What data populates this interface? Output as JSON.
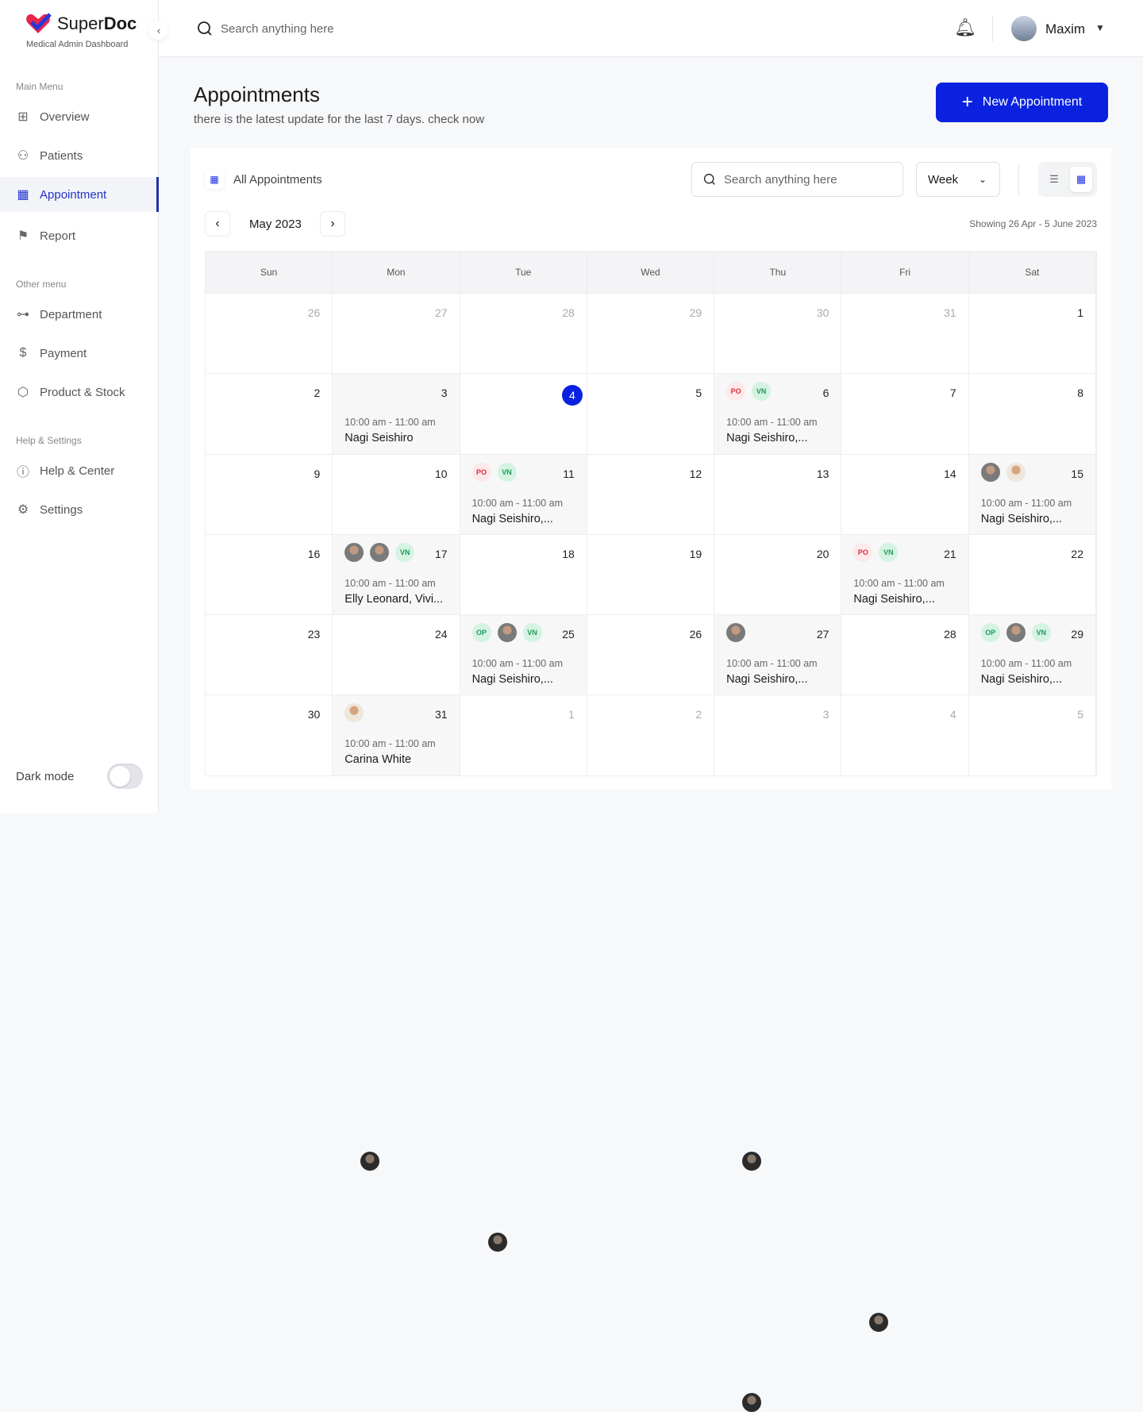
{
  "brand": {
    "name_a": "Super",
    "name_b": "Doc",
    "subtitle": "Medical Admin Dashboard",
    "accent": "#0a22e0"
  },
  "sidebar": {
    "main_label": "Main Menu",
    "main": [
      {
        "label": "Overview",
        "icon": "grid-icon"
      },
      {
        "label": "Patients",
        "icon": "users-icon"
      },
      {
        "label": "Appointment",
        "icon": "calendar-icon",
        "active": true
      },
      {
        "label": "Report",
        "icon": "flag-icon"
      }
    ],
    "other_label": "Other menu",
    "other": [
      {
        "label": "Department",
        "icon": "hierarchy-icon"
      },
      {
        "label": "Payment",
        "icon": "dollar-icon"
      },
      {
        "label": "Product & Stock",
        "icon": "box-icon"
      }
    ],
    "help_label": "Help & Settings",
    "help": [
      {
        "label": "Help & Center",
        "icon": "info-icon"
      },
      {
        "label": "Settings",
        "icon": "gear-icon"
      }
    ],
    "dark_mode": "Dark mode",
    "dark_mode_on": false
  },
  "topbar": {
    "search_placeholder": "Search anything here",
    "user": "Maxim"
  },
  "page": {
    "title": "Appointments",
    "subtitle": "there is the latest update for the last 7 days. check now",
    "new_button": "New Appointment"
  },
  "calendar": {
    "section": "All Appointments",
    "search_placeholder": "Search anything here",
    "view": "Week",
    "month": "May 2023",
    "showing": "Showing 26 Apr - 5 June 2023",
    "days": [
      "Sun",
      "Mon",
      "Tue",
      "Wed",
      "Thu",
      "Fri",
      "Sat"
    ],
    "weeks": [
      [
        {
          "d": "26",
          "m": true
        },
        {
          "d": "27",
          "m": true
        },
        {
          "d": "28",
          "m": true
        },
        {
          "d": "29",
          "m": true
        },
        {
          "d": "30",
          "m": true
        },
        {
          "d": "31",
          "m": true
        },
        {
          "d": "1"
        }
      ],
      [
        {
          "d": "2"
        },
        {
          "d": "3",
          "ev": {
            "avatars": [
              "dark"
            ],
            "time": "10:00 am - 11:00 am",
            "name": "Nagi Seishiro"
          }
        },
        {
          "d": "4",
          "today": true
        },
        {
          "d": "5"
        },
        {
          "d": "6",
          "ev": {
            "avatars": [
              "dark",
              "PO",
              "VN"
            ],
            "time": "10:00 am - 11:00 am",
            "name": "Nagi Seishiro,..."
          }
        },
        {
          "d": "7"
        },
        {
          "d": "8"
        }
      ],
      [
        {
          "d": "9"
        },
        {
          "d": "10"
        },
        {
          "d": "11",
          "ev": {
            "avatars": [
              "dark",
              "PO",
              "VN"
            ],
            "time": "10:00 am - 11:00 am",
            "name": "Nagi Seishiro,..."
          }
        },
        {
          "d": "12"
        },
        {
          "d": "13"
        },
        {
          "d": "14"
        },
        {
          "d": "15",
          "ev": {
            "avatars": [
              "grey",
              "light"
            ],
            "time": "10:00 am - 11:00 am",
            "name": "Nagi Seishiro,..."
          }
        }
      ],
      [
        {
          "d": "16"
        },
        {
          "d": "17",
          "ev": {
            "avatars": [
              "grey",
              "grey",
              "VN"
            ],
            "time": "10:00 am - 11:00 am",
            "name": "Elly Leonard, Vivi..."
          }
        },
        {
          "d": "18"
        },
        {
          "d": "19"
        },
        {
          "d": "20"
        },
        {
          "d": "21",
          "ev": {
            "avatars": [
              "dark",
              "PO",
              "VN"
            ],
            "time": "10:00 am - 11:00 am",
            "name": "Nagi Seishiro,..."
          }
        },
        {
          "d": "22"
        }
      ],
      [
        {
          "d": "23"
        },
        {
          "d": "24"
        },
        {
          "d": "25",
          "ev": {
            "avatars": [
              "OP",
              "grey",
              "VN"
            ],
            "time": "10:00 am - 11:00 am",
            "name": "Nagi Seishiro,..."
          }
        },
        {
          "d": "26"
        },
        {
          "d": "27",
          "ev": {
            "avatars": [
              "grey",
              "dark"
            ],
            "time": "10:00 am - 11:00 am",
            "name": "Nagi Seishiro,..."
          }
        },
        {
          "d": "28"
        },
        {
          "d": "29",
          "ev": {
            "avatars": [
              "OP",
              "grey",
              "VN"
            ],
            "time": "10:00 am - 11:00 am",
            "name": "Nagi Seishiro,..."
          }
        }
      ],
      [
        {
          "d": "30"
        },
        {
          "d": "31",
          "ev": {
            "avatars": [
              "light"
            ],
            "time": "10:00 am - 11:00 am",
            "name": "Carina White"
          }
        },
        {
          "d": "1",
          "m": true
        },
        {
          "d": "2",
          "m": true
        },
        {
          "d": "3",
          "m": true
        },
        {
          "d": "4",
          "m": true
        },
        {
          "d": "5",
          "m": true
        }
      ]
    ],
    "badge_colors": {
      "PO": {
        "bg": "#fde8ea",
        "fg": "#d8303e"
      },
      "VN": {
        "bg": "#d4f3e3",
        "fg": "#1f9a5a"
      },
      "OP": {
        "bg": "#d4f3e3",
        "fg": "#1f9a5a"
      }
    }
  }
}
